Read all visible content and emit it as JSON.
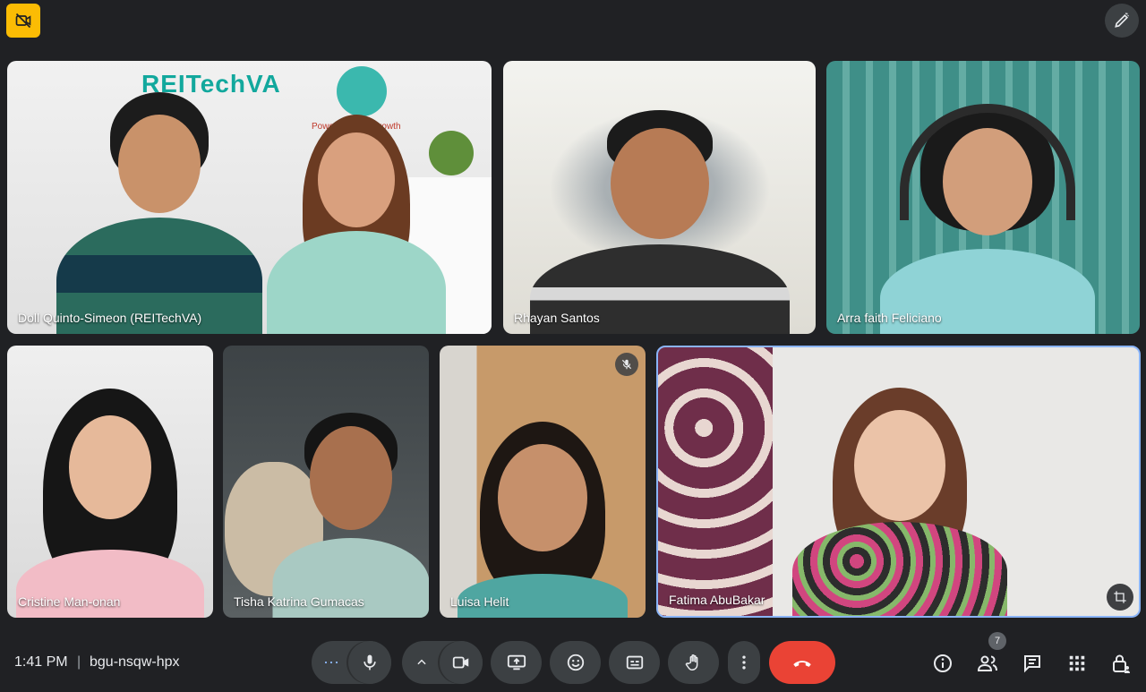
{
  "meeting": {
    "time": "1:41 PM",
    "separator": "|",
    "code": "bgu-nsqw-hpx",
    "participant_count": "7"
  },
  "participants": [
    {
      "name": "Doll Quinto-Simeon (REITechVA)"
    },
    {
      "name": "Rhayan Santos"
    },
    {
      "name": "Arra faith Feliciano"
    },
    {
      "name": "Cristine Man-onan"
    },
    {
      "name": "Tisha Katrina Gumacas"
    },
    {
      "name": "Luisa Helit"
    },
    {
      "name": "Fatima AbuBakar"
    }
  ],
  "backgrounds": {
    "banner_text": "REITechVA",
    "banner_tagline": "Powering Your Growth"
  },
  "controls": {
    "more_options_label": "⋯",
    "end_call_color": "#ea4335"
  },
  "colors": {
    "background": "#202124",
    "control_bg": "#3c4043",
    "recording_badge": "#fbbc04",
    "active_speaker_border": "#8ab4f8"
  }
}
